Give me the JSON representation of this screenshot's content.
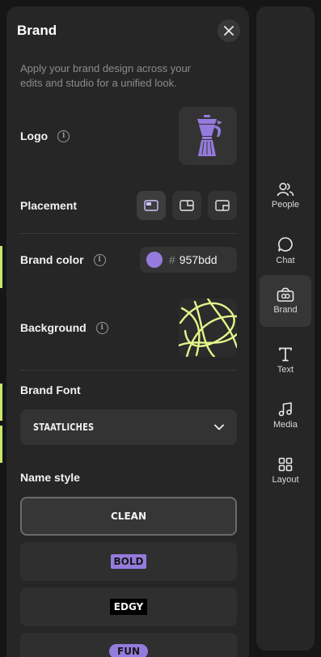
{
  "panel": {
    "title": "Brand",
    "description": "Apply your brand design across your edits and studio for a unified look.",
    "logo": {
      "label": "Logo",
      "image_icon": "moka-pot-icon"
    },
    "placement": {
      "label": "Placement",
      "options": [
        {
          "icon": "placement-top-left-icon",
          "selected": true
        },
        {
          "icon": "placement-top-right-icon",
          "selected": false
        },
        {
          "icon": "placement-bottom-right-icon",
          "selected": false
        }
      ]
    },
    "brand_color": {
      "label": "Brand color",
      "hash": "#",
      "hex": "957bdd",
      "swatch": "#957bdd"
    },
    "background": {
      "label": "Background",
      "thumb_bg": "#2c2c2c",
      "stroke": "#e3f58a"
    },
    "brand_font": {
      "label": "Brand Font",
      "value": "STAATLICHES"
    },
    "name_style": {
      "label": "Name style",
      "options": [
        "CLEAN",
        "BOLD",
        "EDGY",
        "FUN"
      ],
      "selected": "CLEAN"
    }
  },
  "rail": {
    "items": [
      {
        "label": "People",
        "icon": "people-icon"
      },
      {
        "label": "Chat",
        "icon": "chat-icon"
      },
      {
        "label": "Brand",
        "icon": "brand-icon",
        "active": true
      },
      {
        "label": "Text",
        "icon": "text-icon"
      },
      {
        "label": "Media",
        "icon": "media-icon"
      },
      {
        "label": "Layout",
        "icon": "layout-icon"
      }
    ]
  },
  "colors": {
    "accent": "#957bdd",
    "edge_strip": "#c8e86a",
    "panel_bg": "#262626",
    "page_bg": "#161616"
  }
}
